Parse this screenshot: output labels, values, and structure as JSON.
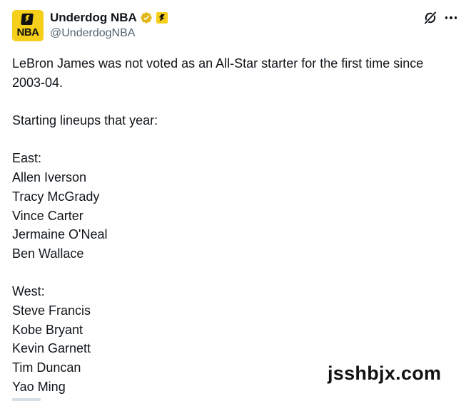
{
  "post": {
    "author": {
      "display_name": "Underdog NBA",
      "handle": "@UnderdogNBA",
      "avatar_text": "NBA",
      "avatar_icon": "underdog-logo-icon",
      "verified_icon": "gold-verified-checkmark-icon",
      "affiliate_badge_icon": "underdog-affiliate-badge-icon"
    },
    "actions": {
      "grok_icon": "grok-icon",
      "more_icon": "more-options-icon"
    },
    "text": {
      "intro_line1": "LeBron James was not voted as an All-Star starter for the first time since",
      "intro_line2": "2003-04.",
      "lineups_heading": "Starting lineups that year:",
      "east_heading": "East:",
      "east": [
        "Allen Iverson",
        "Tracy McGrady",
        "Vince Carter",
        "Jermaine O'Neal",
        "Ben Wallace"
      ],
      "west_heading": "West:",
      "west": [
        "Steve Francis",
        "Kobe Bryant",
        "Kevin Garnett",
        "Tim Duncan",
        "Yao Ming"
      ]
    }
  },
  "watermark": "jsshbjx.com",
  "colors": {
    "text": "#0f1419",
    "secondary_text": "#536471",
    "brand_yellow": "#f5cf1a",
    "verified_gold": "#e2b719"
  }
}
